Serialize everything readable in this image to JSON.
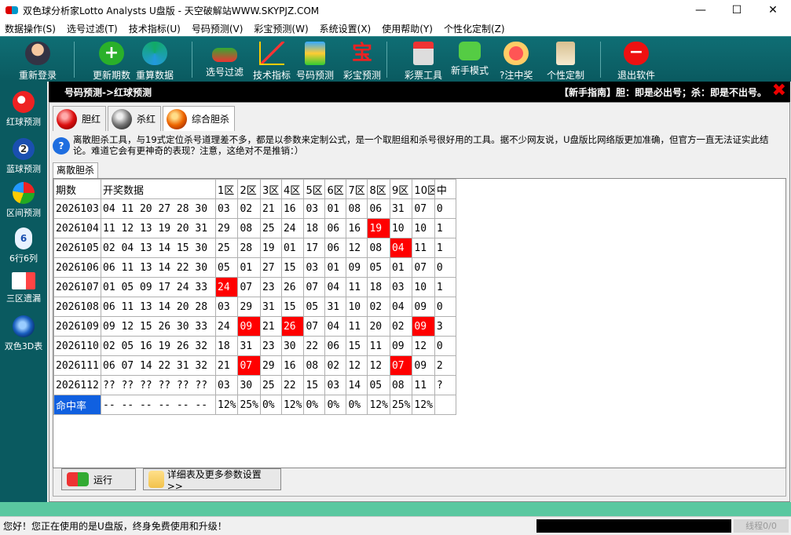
{
  "window": {
    "title": "双色球分析家Lotto Analysts U盘版 - 天空破解站WWW.SKYPJZ.COM",
    "min": "—",
    "max": "☐",
    "close": "✕"
  },
  "menu": [
    "数据操作(S)",
    "选号过滤(T)",
    "技术指标(U)",
    "号码预测(V)",
    "彩宝预测(W)",
    "系统设置(X)",
    "使用帮助(Y)",
    "个性化定制(Z)"
  ],
  "toolbar": {
    "relogin": "重新登录",
    "update": "更新期数",
    "recalc": "重算数据",
    "filter": "选号过滤",
    "indicator": "技术指标",
    "predict": "号码预测",
    "treasure": "彩宝预测",
    "tools": "彩票工具",
    "newbie": "新手模式",
    "win": "?注中奖",
    "custom": "个性定制",
    "exit": "退出软件"
  },
  "sidebar": [
    "红球预测",
    "蓝球预测",
    "区间预测",
    "6行6列",
    "三区遗漏",
    "双色3D表"
  ],
  "header": {
    "breadcrumb": "号码预测->红球预测",
    "guide": "【新手指南】胆：即是必出号；杀：即是不出号。",
    "close": "✖"
  },
  "tabs": [
    "胆红",
    "杀红",
    "综合胆杀"
  ],
  "info_text": "离散胆杀工具，与19式定位杀号道理差不多，都是以参数来定制公式，是一个取胆组和杀号很好用的工具。据不少网友说，U盘版比网络版更加准确，但官方一直无法证实此结论。难道它会有更神奇的表现？注意，这绝对不是推销：）",
  "subtab": "离散胆杀",
  "table": {
    "headers": [
      "期数",
      "开奖数据",
      "1区",
      "2区",
      "3区",
      "4区",
      "5区",
      "6区",
      "7区",
      "8区",
      "9区",
      "10区",
      "中"
    ],
    "rows": [
      {
        "period": "2026103",
        "draw": "04 11 20 27 28 30",
        "zones": [
          "03",
          "02",
          "21",
          "16",
          "03",
          "01",
          "08",
          "06",
          "31",
          "07"
        ],
        "hit": "0",
        "hits": []
      },
      {
        "period": "2026104",
        "draw": "11 12 13 19 20 31",
        "zones": [
          "29",
          "08",
          "25",
          "24",
          "18",
          "06",
          "16",
          "19",
          "10",
          "10"
        ],
        "hit": "1",
        "hits": [
          7
        ]
      },
      {
        "period": "2026105",
        "draw": "02 04 13 14 15 30",
        "zones": [
          "25",
          "28",
          "19",
          "01",
          "17",
          "06",
          "12",
          "08",
          "04",
          "11"
        ],
        "hit": "1",
        "hits": [
          8
        ]
      },
      {
        "period": "2026106",
        "draw": "06 11 13 14 22 30",
        "zones": [
          "05",
          "01",
          "27",
          "15",
          "03",
          "01",
          "09",
          "05",
          "01",
          "07"
        ],
        "hit": "0",
        "hits": []
      },
      {
        "period": "2026107",
        "draw": "01 05 09 17 24 33",
        "zones": [
          "24",
          "07",
          "23",
          "26",
          "07",
          "04",
          "11",
          "18",
          "03",
          "10"
        ],
        "hit": "1",
        "hits": [
          0
        ]
      },
      {
        "period": "2026108",
        "draw": "06 11 13 14 20 28",
        "zones": [
          "03",
          "29",
          "31",
          "15",
          "05",
          "31",
          "10",
          "02",
          "04",
          "09"
        ],
        "hit": "0",
        "hits": []
      },
      {
        "period": "2026109",
        "draw": "09 12 15 26 30 33",
        "zones": [
          "24",
          "09",
          "21",
          "26",
          "07",
          "04",
          "11",
          "20",
          "02",
          "09"
        ],
        "hit": "3",
        "hits": [
          1,
          3,
          9
        ]
      },
      {
        "period": "2026110",
        "draw": "02 05 16 19 26 32",
        "zones": [
          "18",
          "31",
          "23",
          "30",
          "22",
          "06",
          "15",
          "11",
          "09",
          "12"
        ],
        "hit": "0",
        "hits": []
      },
      {
        "period": "2026111",
        "draw": "06 07 14 22 31 32",
        "zones": [
          "21",
          "07",
          "29",
          "16",
          "08",
          "02",
          "12",
          "12",
          "07",
          "09"
        ],
        "hit": "2",
        "hits": [
          1,
          8
        ]
      },
      {
        "period": "2026112",
        "draw": "?? ?? ?? ?? ?? ??",
        "zones": [
          "03",
          "30",
          "25",
          "22",
          "15",
          "03",
          "14",
          "05",
          "08",
          "11"
        ],
        "hit": "?",
        "hits": []
      }
    ],
    "rate": {
      "label": "命中率",
      "draw": "-- -- -- -- -- --",
      "zones": [
        "12%",
        "25%",
        "0%",
        "12%",
        "0%",
        "0%",
        "0%",
        "12%",
        "25%",
        "12%"
      ],
      "hit": ""
    }
  },
  "buttons": {
    "run": "运行",
    "detail": "详细表及更多参数设置>>"
  },
  "status": {
    "message": "您好！您正在使用的是U盘版，终身免费使用和升级！",
    "threads": "线程0/0"
  }
}
